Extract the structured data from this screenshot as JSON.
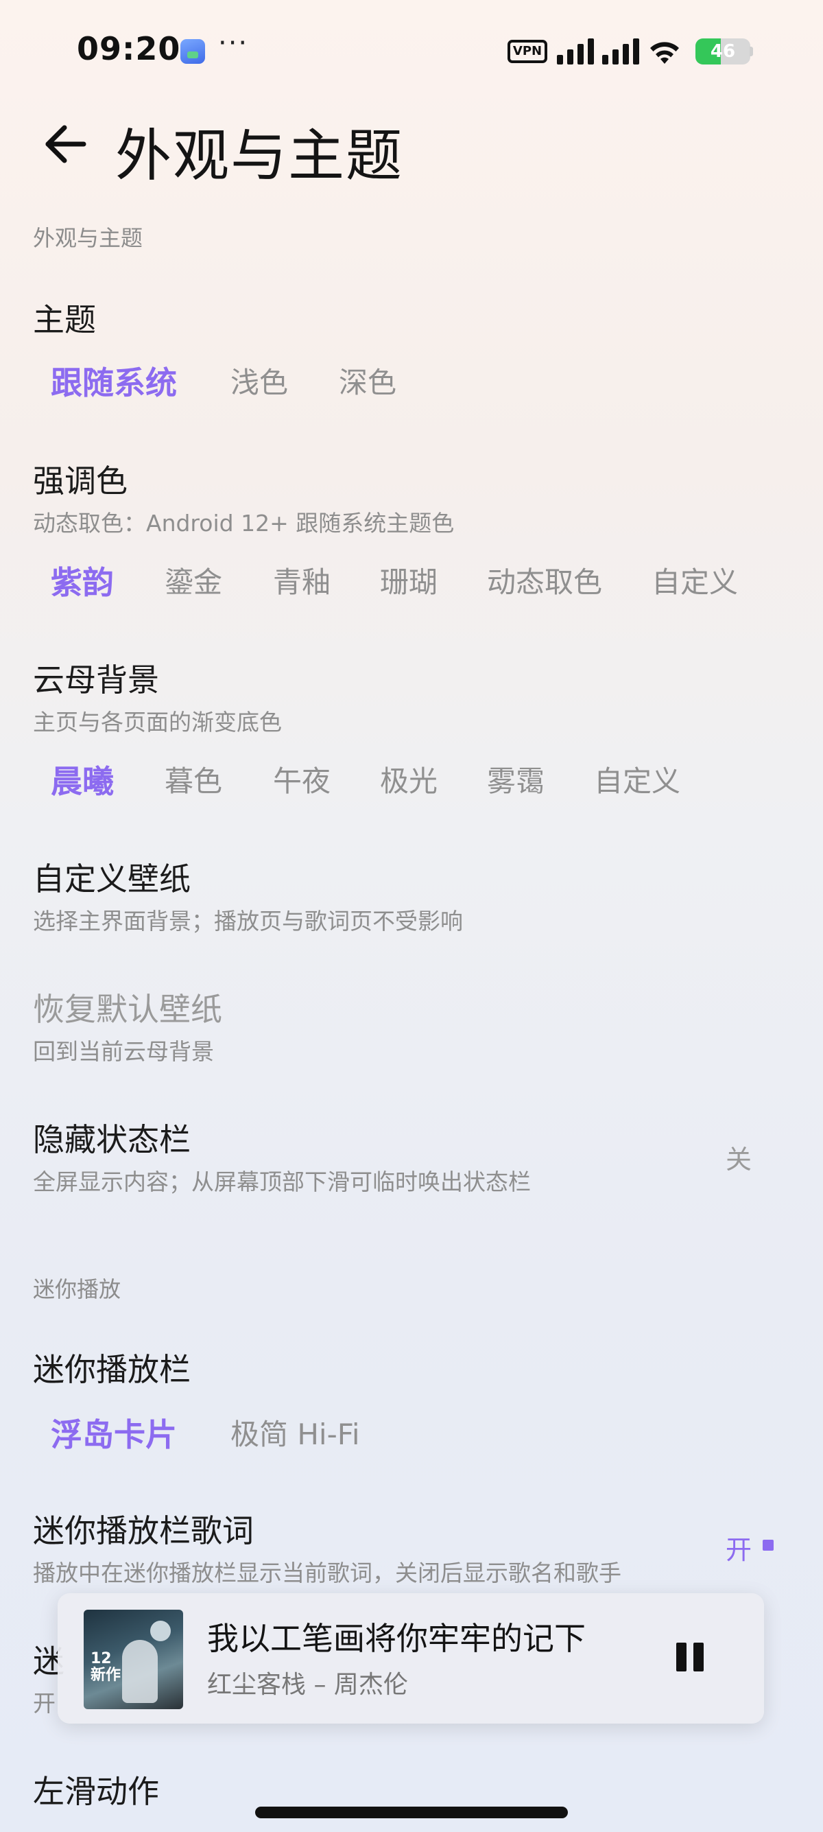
{
  "status_bar": {
    "time": "09:20",
    "more": "···",
    "vpn": "VPN",
    "battery": "46",
    "battery_level": 0.46,
    "app_icon": "app-notification-icon"
  },
  "header": {
    "title": "外观与主题",
    "back_icon": "arrow-left-icon"
  },
  "sections": {
    "appearance": "外观与主题",
    "mini_play": "迷你播放"
  },
  "theme": {
    "title": "主题",
    "options": [
      "跟随系统",
      "浅色",
      "深色"
    ],
    "selected": "跟随系统"
  },
  "accent": {
    "title": "强调色",
    "subtitle": "动态取色：Android 12+ 跟随系统主题色",
    "options": [
      "紫韵",
      "鎏金",
      "青釉",
      "珊瑚",
      "动态取色",
      "自定义"
    ],
    "selected": "紫韵"
  },
  "mica": {
    "title": "云母背景",
    "subtitle": "主页与各页面的渐变底色",
    "options": [
      "晨曦",
      "暮色",
      "午夜",
      "极光",
      "雾霭",
      "自定义"
    ],
    "selected": "晨曦"
  },
  "wallpaper": {
    "title": "自定义壁纸",
    "subtitle": "选择主界面背景；播放页与歌词页不受影响"
  },
  "restore_wallpaper": {
    "title": "恢复默认壁纸",
    "subtitle": "回到当前云母背景"
  },
  "hide_status_bar": {
    "title": "隐藏状态栏",
    "subtitle": "全屏显示内容；从屏幕顶部下滑可临时唤出状态栏",
    "value": "关"
  },
  "mini_bar": {
    "title": "迷你播放栏",
    "options": [
      "浮岛卡片",
      "极简 Hi-Fi"
    ],
    "selected": "浮岛卡片"
  },
  "mini_lyrics": {
    "title": "迷你播放栏歌词",
    "subtitle": "播放中在迷你播放栏显示当前歌词，关闭后显示歌名和歌手",
    "value": "开"
  },
  "partial_row": {
    "title": "迷",
    "subtitle": "开"
  },
  "swipe_left": {
    "title": "左滑动作"
  },
  "player": {
    "song": "我以工笔画将你牢牢的记下",
    "artist": "红尘客栈 – 周杰伦",
    "album_badge": "12\n新作",
    "pause_icon": "pause-icon",
    "accent_color": "#8c6bf0"
  }
}
